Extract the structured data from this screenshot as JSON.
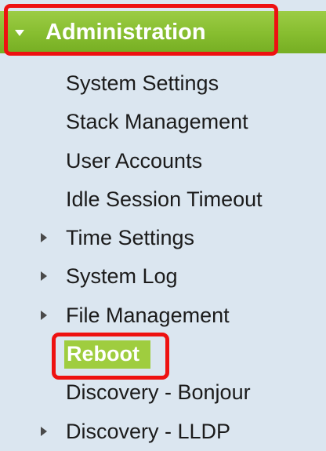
{
  "header": {
    "title": "Administration",
    "arrow_icon": "triangle-down-icon"
  },
  "menu": {
    "items": [
      {
        "label": "System Settings",
        "expandable": false
      },
      {
        "label": "Stack Management",
        "expandable": false
      },
      {
        "label": "User Accounts",
        "expandable": false
      },
      {
        "label": "Idle Session Timeout",
        "expandable": false
      },
      {
        "label": "Time Settings",
        "expandable": true
      },
      {
        "label": "System Log",
        "expandable": true
      },
      {
        "label": "File Management",
        "expandable": true
      },
      {
        "label": "Reboot",
        "expandable": false,
        "selected": true
      },
      {
        "label": "Discovery - Bonjour",
        "expandable": false
      },
      {
        "label": "Discovery - LLDP",
        "expandable": true
      }
    ]
  },
  "colors": {
    "header_green": "#86bd2f",
    "selected_green": "#9fcd3f",
    "menu_background": "#dbe6f0",
    "highlight_red": "#ee1111"
  }
}
